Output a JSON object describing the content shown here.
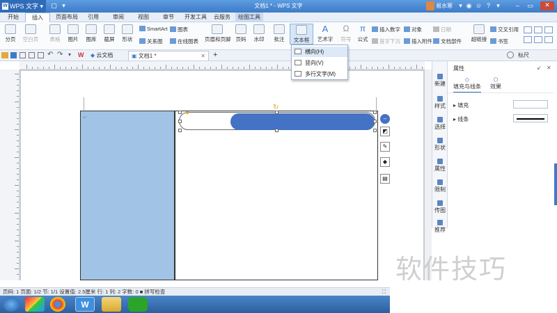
{
  "app": {
    "button_label": "WPS 文字",
    "logo_letter": "W",
    "window_title": "文档1 * - WPS 文字",
    "user_name": "易水寒"
  },
  "menu": {
    "tabs": [
      {
        "label": "开始"
      },
      {
        "label": "插入"
      },
      {
        "label": "页面布局"
      },
      {
        "label": "引用"
      },
      {
        "label": "审阅"
      },
      {
        "label": "视图"
      },
      {
        "label": "章节"
      },
      {
        "label": "开发工具"
      },
      {
        "label": "云服务"
      },
      {
        "label": "绘图工具"
      }
    ],
    "active": "插入"
  },
  "ribbon": {
    "fenye": "分页",
    "kongbaiye": "空白页",
    "biaoge": "表格",
    "tupian": "图片",
    "tuku": "图库",
    "jietu": "截屏",
    "xingzhuang": "形状",
    "smartart": "SmartArt",
    "tubiao": "图表",
    "guanxitu": "关系图",
    "zaixiantubiao": "在线图表",
    "yemei": "页眉和页脚",
    "yema": "页码",
    "shuiyin": "水印",
    "pizhu": "批注",
    "wenbenkuang": "文本框",
    "yishuzi": "艺术字",
    "fuhao": "符号",
    "gongshi": "公式",
    "charushuzi": "插入数字",
    "duixiang": "对象",
    "riqi": "日期",
    "shouziixiachen": "首字下沉",
    "charufujian": "插入附件",
    "wendangbujian": "文档部件",
    "chaolianjie": "超链接",
    "jiaochayinyong": "交叉引用",
    "shuqian": "书签"
  },
  "dropdown": {
    "items": [
      {
        "label": "横向(H)"
      },
      {
        "label": "竖向(V)"
      },
      {
        "label": "多行文字(M)"
      }
    ]
  },
  "doctabs": {
    "yun": "云文档",
    "doc1": "文档1 *",
    "add": "+",
    "ruler_label": "标尺"
  },
  "right_tabs": [
    "新建",
    "样式",
    "选择",
    "形状",
    "属性",
    "限制",
    "传图",
    "推荐"
  ],
  "props": {
    "title": "属性",
    "tab_fill": "填充与线条",
    "tab_effect": "效果",
    "fill_label": "填充",
    "line_label": "线条"
  },
  "statusbar": {
    "text": "页码: 1  页面: 1/2  节: 1/1  设置值: 2.5厘米  行: 1  列: 2  字数: 0  ■ 拼写检查"
  },
  "watermark": "软件技巧",
  "colors": {
    "blue_pill": "#4472c4",
    "blue_column": "#a0c3e6",
    "accent": "#2f6bb8"
  }
}
